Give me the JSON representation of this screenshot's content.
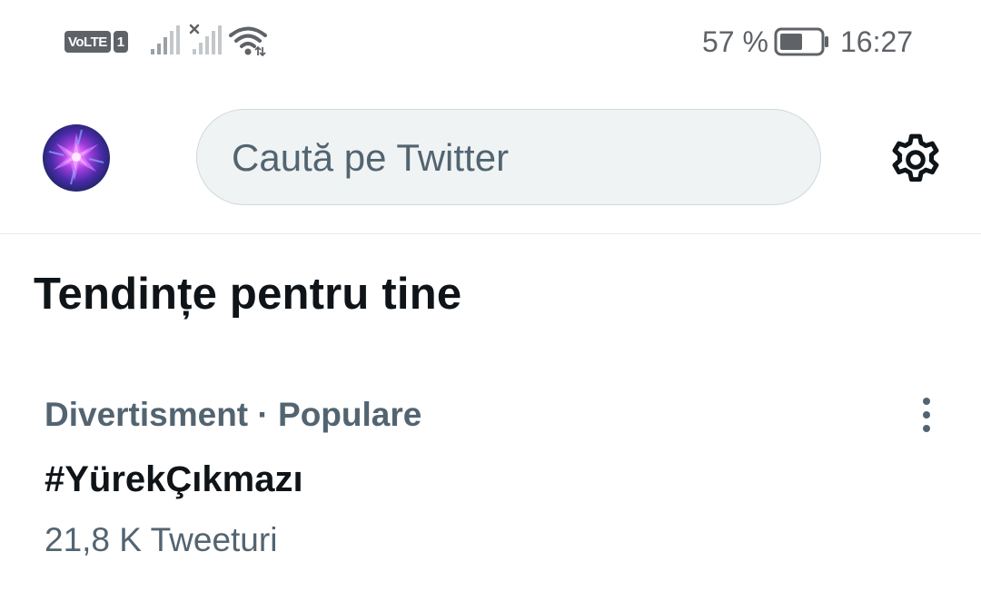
{
  "status_bar": {
    "volte_label": "VoLTE",
    "sim_number": "1",
    "battery_percent": "57 %",
    "battery_level": 0.57,
    "time": "16:27",
    "icons": [
      "signal-bars-icon",
      "no-signal-icon",
      "wifi-icon",
      "battery-icon"
    ],
    "text_color": "#5f6368"
  },
  "header": {
    "avatar_icon": "avatar",
    "search": {
      "placeholder": "Caută pe Twitter",
      "value": ""
    },
    "settings_icon": "gear-icon"
  },
  "trends": {
    "title": "Tendințe pentru tine",
    "items": [
      {
        "meta": "Divertisment · Populare",
        "name": "#YürekÇıkmazı",
        "count": "21,8 K Tweeturi",
        "more_icon": "more-vertical-icon"
      }
    ]
  },
  "colors": {
    "primary_text": "#0f1419",
    "secondary_text": "#536471",
    "search_bg": "#eff3f4",
    "divider": "#e6ecf0"
  }
}
